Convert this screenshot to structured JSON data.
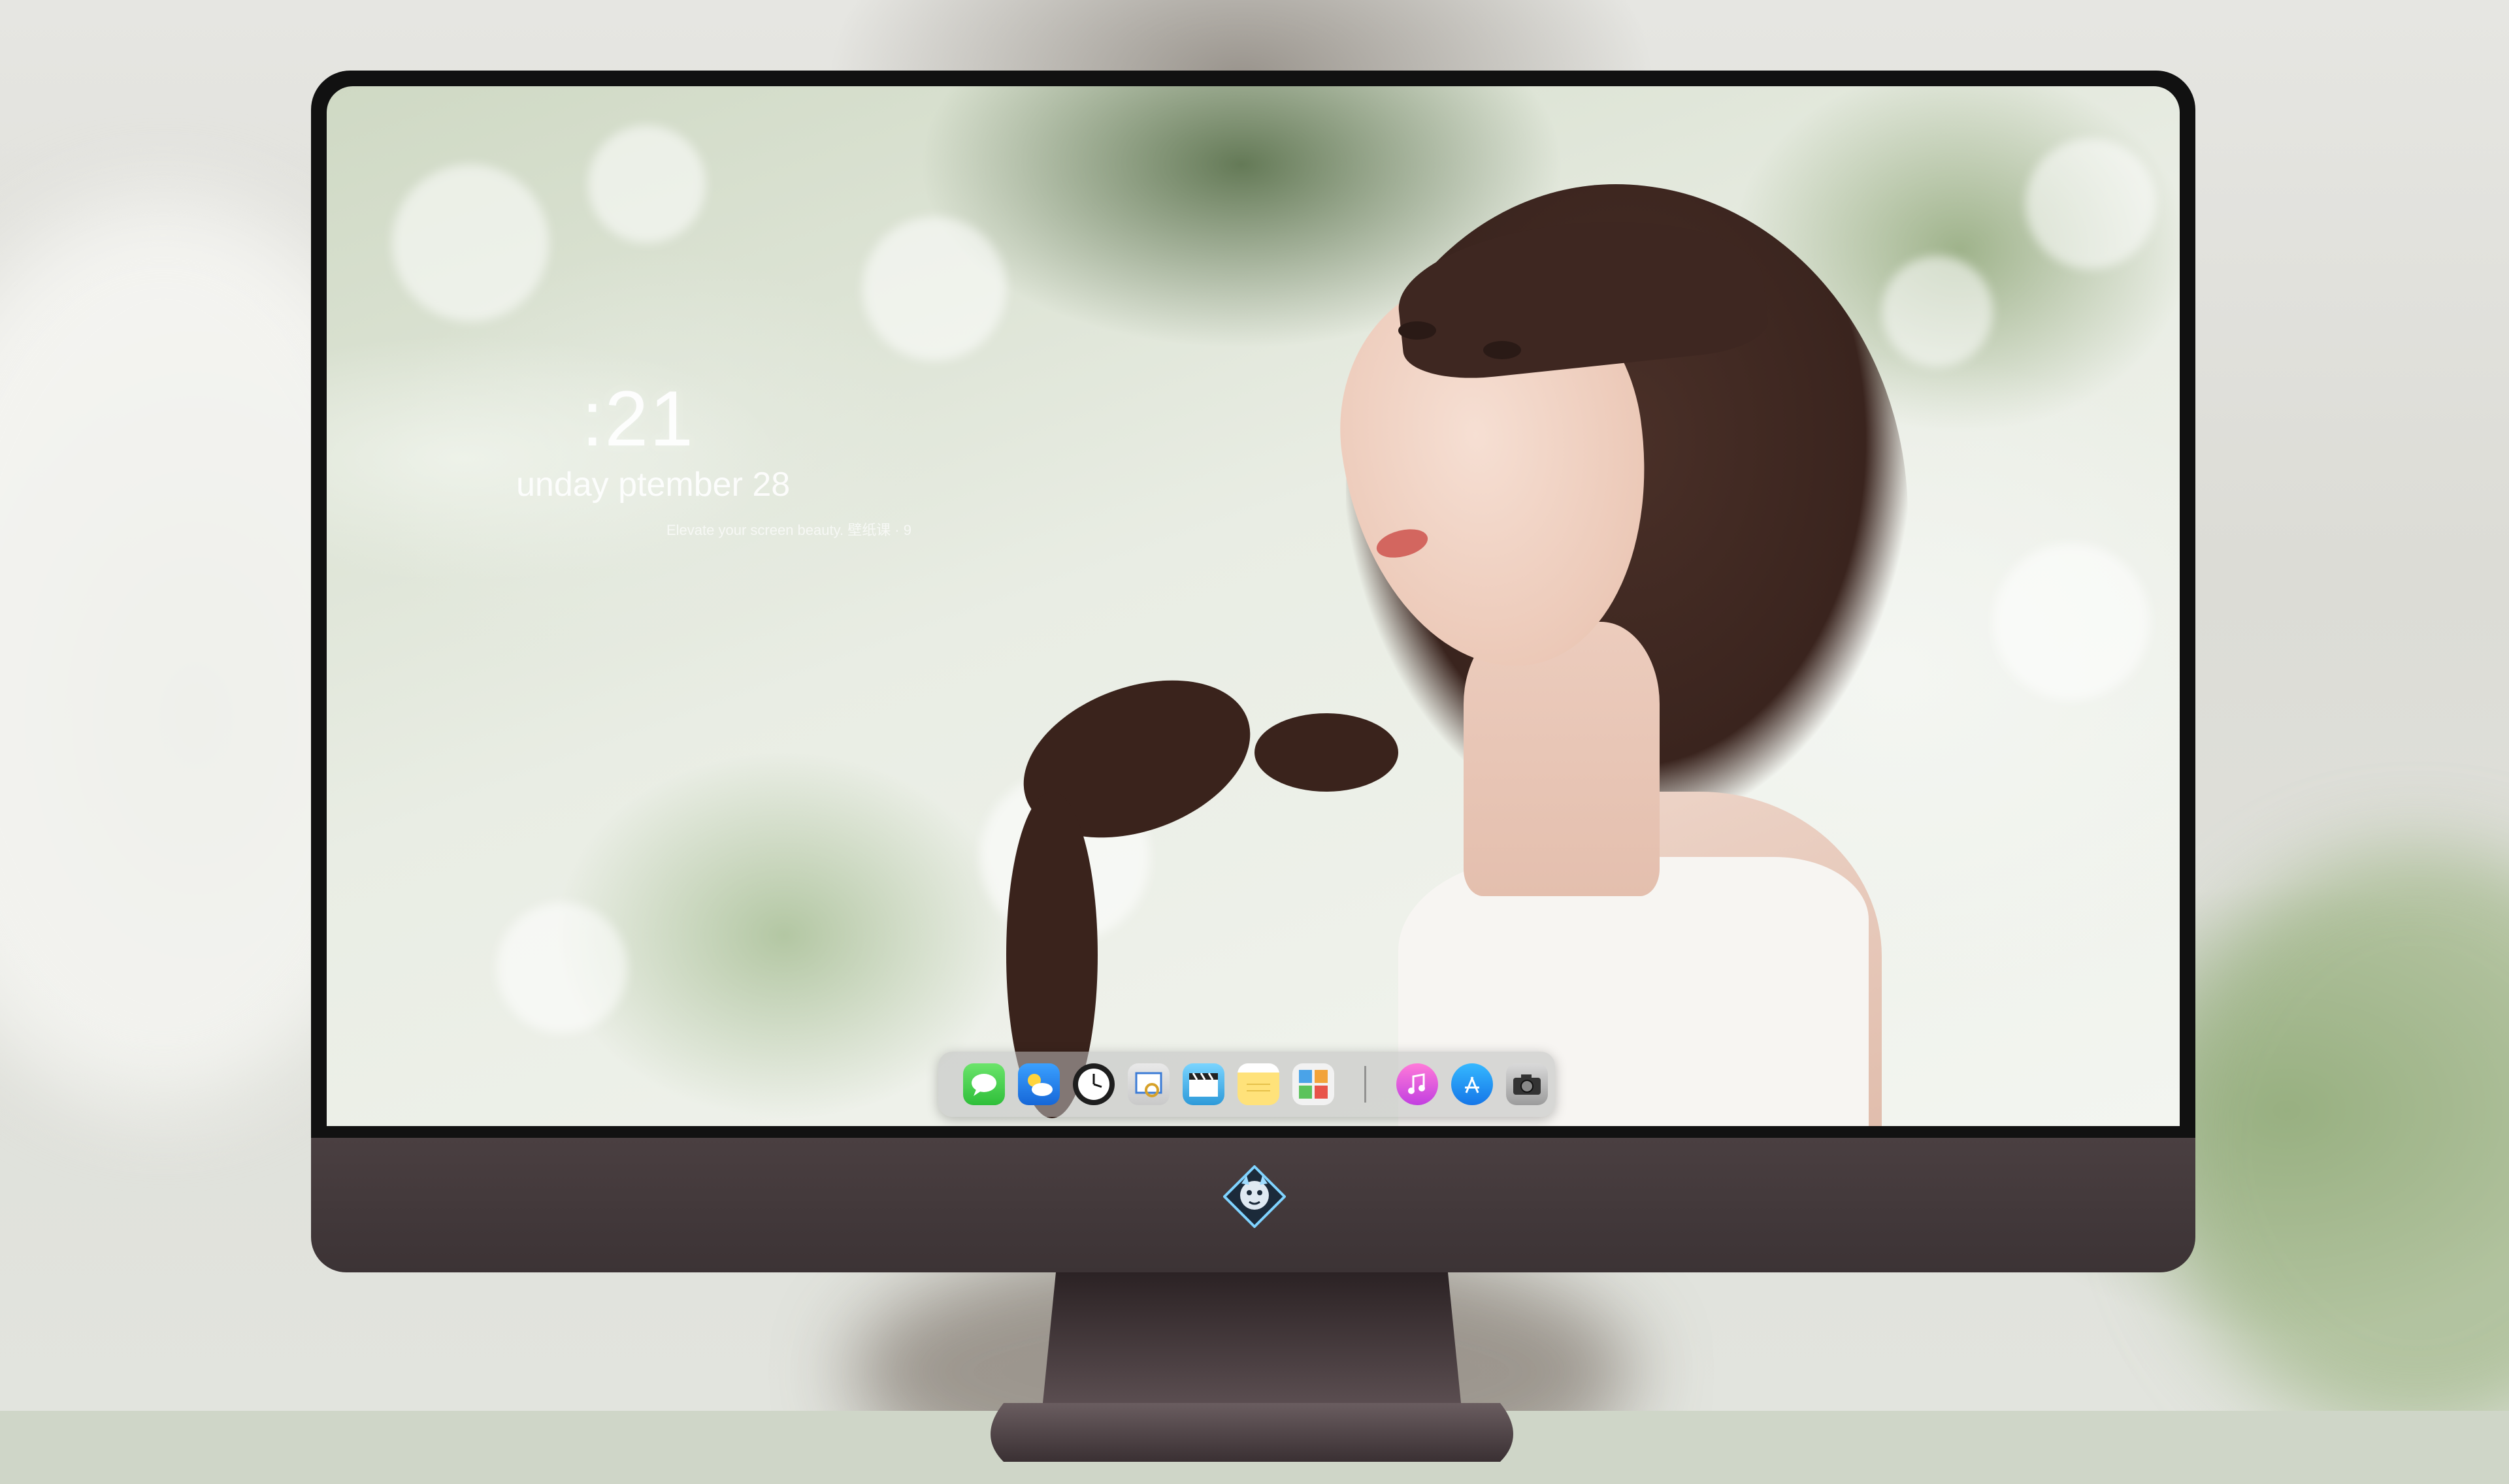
{
  "lockscreen": {
    "time": ":21",
    "date": "unday  ptember  28",
    "caption": "Elevate your screen beauty. 壁纸课 · 9"
  },
  "dock": {
    "apps": [
      {
        "name": "Messages",
        "icon": "messages-icon"
      },
      {
        "name": "Weather",
        "icon": "weather-icon"
      },
      {
        "name": "Clock",
        "icon": "clock-icon"
      },
      {
        "name": "Preview",
        "icon": "preview-icon"
      },
      {
        "name": "Clips",
        "icon": "clapperboard-icon"
      },
      {
        "name": "Notes",
        "icon": "notes-icon"
      },
      {
        "name": "Photo Gallery",
        "icon": "gallery-icon"
      },
      {
        "name": "Music",
        "icon": "music-icon"
      },
      {
        "name": "App Store",
        "icon": "app-store-icon"
      },
      {
        "name": "Camera",
        "icon": "camera-icon"
      }
    ]
  },
  "colors": {
    "chin": "#3c3335",
    "bezel": "#111111",
    "dock_bg": "rgba(190,190,190,0.55)"
  },
  "monitor_logo": "dragon-mascot-logo"
}
